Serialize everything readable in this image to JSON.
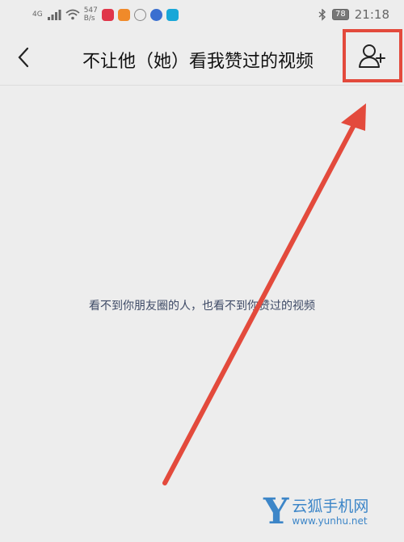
{
  "status_bar": {
    "network_badge": "4G",
    "speed_value": "547",
    "speed_unit": "B/s",
    "battery": "78",
    "time": "21:18"
  },
  "header": {
    "title": "不让他（她）看我赞过的视频"
  },
  "main": {
    "empty_text": "看不到你朋友圈的人，也看不到你赞过的视频"
  },
  "watermark": {
    "logo": "Y",
    "name": "云狐手机网",
    "url": "www.yunhu.net"
  },
  "colors": {
    "background": "#ededed",
    "annotation_red": "#e34a3c",
    "empty_text": "#3e4a66",
    "watermark_blue": "#3d86c8"
  },
  "icons": [
    "signal-icon",
    "wifi-icon",
    "bluetooth-icon",
    "battery-icon",
    "back-arrow-icon",
    "add-user-icon"
  ]
}
